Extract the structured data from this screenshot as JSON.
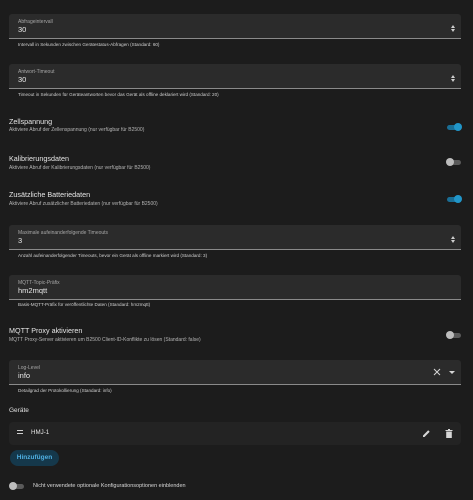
{
  "fields": {
    "poll_interval": {
      "label": "Abfrageintervall",
      "value": "30",
      "helper": "Intervall in Sekunden zwischen Gerätestatus-Abfragen (Standard: 60)"
    },
    "response_timeout": {
      "label": "Antwort-Timeout",
      "value": "30",
      "helper": "Timeout in Sekunden für Geräteantworten bevor das Gerät als offline deklariert wird (Standard: 20)"
    },
    "max_timeouts": {
      "label": "Maximale aufeinanderfolgende Timeouts",
      "value": "3",
      "helper": "Anzahl aufeinanderfolgender Timeouts, bevor ein Gerät als offline markiert wird (Standard: 3)"
    },
    "mqtt_prefix": {
      "label": "MQTT-Topic-Präfix",
      "value": "hm2mqtt",
      "helper": "Basis-MQTT-Präfix für veröffentlichte Daten (Standard: hm2mqtt)"
    },
    "log_level": {
      "label": "Log-Level",
      "value": "info",
      "helper": "Detailgrad der Protokollierung (Standard: info)"
    }
  },
  "toggles": {
    "cell_voltage": {
      "title": "Zellspannung",
      "subtitle": "Aktiviere Abruf der Zellenspannung (nur verfügbar für B2500)",
      "state": "on"
    },
    "calibration": {
      "title": "Kalibrierungsdaten",
      "subtitle": "Aktiviere Abruf der Kalibrierungsdaten (nur verfügbar für B2500)",
      "state": "off"
    },
    "battery": {
      "title": "Zusätzliche Batteriedaten",
      "subtitle": "Aktiviere Abruf zusätzlicher Batteriedaten (nur verfügbar für B2500)",
      "state": "on"
    },
    "mqtt_proxy": {
      "title": "MQTT Proxy aktivieren",
      "subtitle": "MQTT Proxy-Server aktivieren um B2500 Client-ID-Konflikte zu lösen (Standard: false)",
      "state": "off"
    },
    "show_optional": {
      "label": "Nicht verwendete optionale Konfigurationsoptionen einblenden",
      "state": "off"
    }
  },
  "devices": {
    "title": "Geräte",
    "items": [
      {
        "name": "HMJ-1"
      }
    ],
    "add_label": "Hinzufügen"
  },
  "icons": [
    "drag-handle-icon",
    "edit-icon",
    "delete-icon",
    "clear-icon",
    "dropdown-arrow-icon",
    "spinner-up-icon",
    "spinner-down-icon"
  ],
  "colors": {
    "background": "#1c1c1c",
    "field": "#2b2b2b",
    "accent": "#2196c9"
  }
}
